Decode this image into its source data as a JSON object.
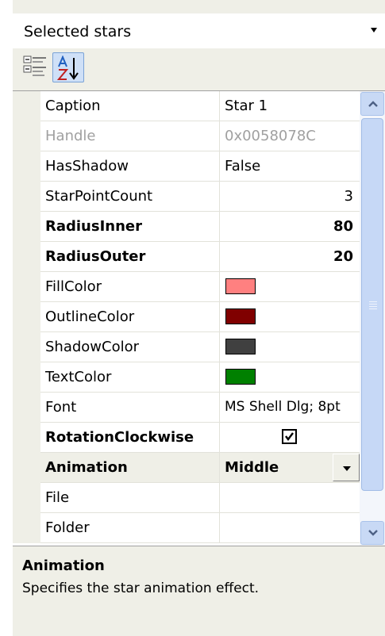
{
  "selector": {
    "value": "Selected stars"
  },
  "toolbar": {
    "categorized_icon": "categorized-icon",
    "alphabetical_icon": "alphabetical-sort-icon"
  },
  "properties": [
    {
      "name": "Caption",
      "value": "Star 1"
    },
    {
      "name": "Handle",
      "value": "0x0058078C"
    },
    {
      "name": "HasShadow",
      "value": "False"
    },
    {
      "name": "StarPointCount",
      "value": "3"
    },
    {
      "name": "RadiusInner",
      "value": "80"
    },
    {
      "name": "RadiusOuter",
      "value": "20"
    },
    {
      "name": "FillColor",
      "color": "#ff8080"
    },
    {
      "name": "OutlineColor",
      "color": "#800000"
    },
    {
      "name": "ShadowColor",
      "color": "#404040"
    },
    {
      "name": "TextColor",
      "color": "#008000"
    },
    {
      "name": "Font",
      "value": "MS Shell Dlg; 8pt"
    },
    {
      "name": "RotationClockwise",
      "checked": true
    },
    {
      "name": "Animation",
      "value": "Middle"
    },
    {
      "name": "File",
      "value": ""
    },
    {
      "name": "Folder",
      "value": ""
    }
  ],
  "description": {
    "title": "Animation",
    "text": "Specifies the star animation effect."
  }
}
